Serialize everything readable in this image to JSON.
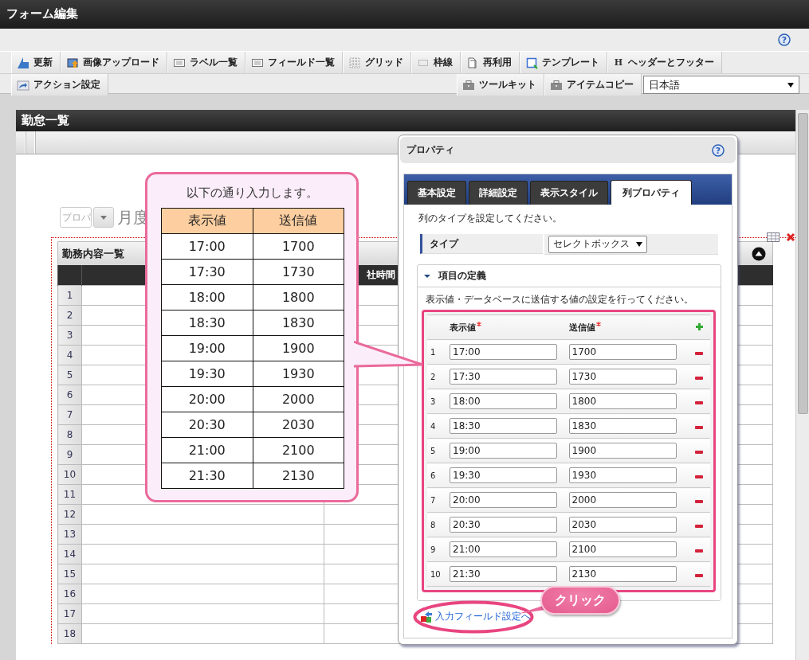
{
  "window": {
    "title": "フォーム編集",
    "help": "?"
  },
  "toolbar": {
    "row1": [
      {
        "label": "更新"
      },
      {
        "label": "画像アップロード"
      },
      {
        "label": "ラベル一覧"
      },
      {
        "label": "フィールド一覧"
      },
      {
        "label": "グリッド"
      },
      {
        "label": "枠線"
      },
      {
        "label": "再利用"
      },
      {
        "label": "テンプレート"
      },
      {
        "label": "ヘッダーとフッター",
        "glyph": "H"
      }
    ],
    "row2_left": [
      {
        "label": "アクション設定"
      }
    ],
    "row2_right": [
      {
        "label": "ツールキット"
      },
      {
        "label": "アイテムコピー"
      }
    ],
    "language_select": {
      "value": "日本語"
    }
  },
  "form": {
    "title": "勤怠一覧",
    "period_select": {
      "placeholder": "プロパ"
    },
    "period_label": "月度",
    "table": {
      "title": "勤務内容一覧",
      "column_3": "社時間",
      "row_numbers": [
        "1",
        "2",
        "3",
        "4",
        "5",
        "6",
        "7",
        "8",
        "9",
        "10",
        "11",
        "12",
        "13",
        "14",
        "15",
        "16",
        "17",
        "18"
      ]
    }
  },
  "callout": {
    "text": "以下の通り入力します。",
    "columns": [
      "表示値",
      "送信値"
    ],
    "rows": [
      [
        "17:00",
        "1700"
      ],
      [
        "17:30",
        "1730"
      ],
      [
        "18:00",
        "1800"
      ],
      [
        "18:30",
        "1830"
      ],
      [
        "19:00",
        "1900"
      ],
      [
        "19:30",
        "1930"
      ],
      [
        "20:00",
        "2000"
      ],
      [
        "20:30",
        "2030"
      ],
      [
        "21:00",
        "2100"
      ],
      [
        "21:30",
        "2130"
      ]
    ]
  },
  "properties": {
    "title": "プロパティ",
    "help": "?",
    "tabs": [
      {
        "label": "基本設定",
        "selected": false
      },
      {
        "label": "詳細設定",
        "selected": false
      },
      {
        "label": "表示スタイル",
        "selected": false
      },
      {
        "label": "列プロパティ",
        "selected": true
      }
    ],
    "instruction": "列のタイプを設定してください。",
    "type_field": {
      "label": "タイプ",
      "value": "セレクトボックス"
    },
    "section": {
      "title": "項目の定義",
      "expanded": true,
      "instruction": "表示値・データベースに送信する値の設定を行ってください。",
      "columns": [
        {
          "label": "表示値",
          "required": true
        },
        {
          "label": "送信値",
          "required": true
        }
      ],
      "rows": [
        {
          "number": "1",
          "display": "17:00",
          "send": "1700"
        },
        {
          "number": "2",
          "display": "17:30",
          "send": "1730"
        },
        {
          "number": "3",
          "display": "18:00",
          "send": "1800"
        },
        {
          "number": "4",
          "display": "18:30",
          "send": "1830"
        },
        {
          "number": "5",
          "display": "19:00",
          "send": "1900"
        },
        {
          "number": "6",
          "display": "19:30",
          "send": "1930"
        },
        {
          "number": "7",
          "display": "20:00",
          "send": "2000"
        },
        {
          "number": "8",
          "display": "20:30",
          "send": "2030"
        },
        {
          "number": "9",
          "display": "21:00",
          "send": "2100"
        },
        {
          "number": "10",
          "display": "21:30",
          "send": "2130"
        }
      ]
    },
    "link": "入力フィールド設定へ"
  },
  "click_badge": "クリック"
}
